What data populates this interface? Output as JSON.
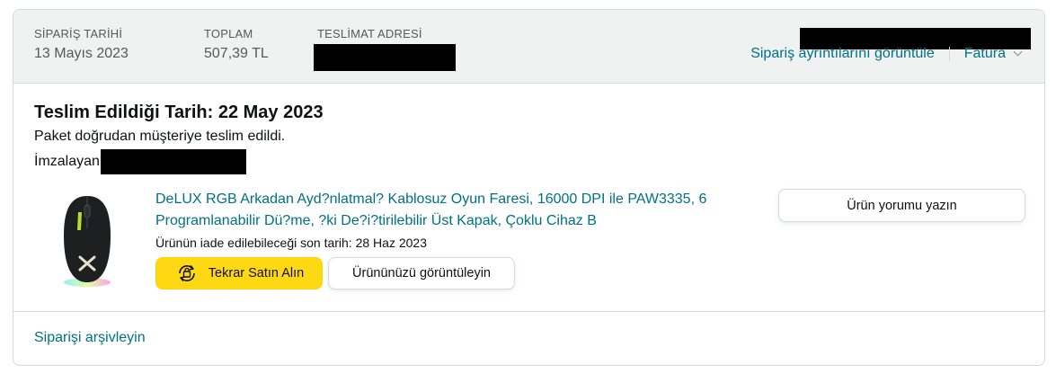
{
  "header": {
    "order_date_label": "SİPARİŞ TARİHİ",
    "order_date_value": "13 Mayıs 2023",
    "total_label": "TOPLAM",
    "total_value": "507,39 TL",
    "address_label": "TESLİMAT ADRESİ",
    "order_details_link": "Sipariş ayrıntılarını görüntüle",
    "invoice_link": "Fatura"
  },
  "delivery": {
    "title": "Teslim Edildiği Tarih: 22 May 2023",
    "subtitle": "Paket doğrudan müşteriye teslim edildi.",
    "signed_label": "İmzalayan"
  },
  "product": {
    "title": "DeLUX RGB Arkadan Ayd?nlatmal? Kablosuz Oyun Faresi, 16000 DPI ile PAW3335, 6 Programlanabilir Dü?me, ?ki De?i?tirilebilir Üst Kapak, Çoklu Cihaz B",
    "return_note": "Ürünün iade edilebileceği son tarih: 28 Haz 2023",
    "rebuy_label": "Tekrar Satın Alın",
    "view_label": "Ürününüzü görüntüleyin",
    "review_label": "Ürün yorumu yazın"
  },
  "footer": {
    "archive_link": "Siparişi arşivleyin"
  },
  "colors": {
    "link": "#007185",
    "header_bg": "#f0f2f2",
    "border": "#d5d9d9",
    "primary_button": "#ffd814"
  },
  "icons": {
    "rebuy": "rebuy-cycle-icon",
    "invoice_dropdown": "chevron-down-icon"
  }
}
